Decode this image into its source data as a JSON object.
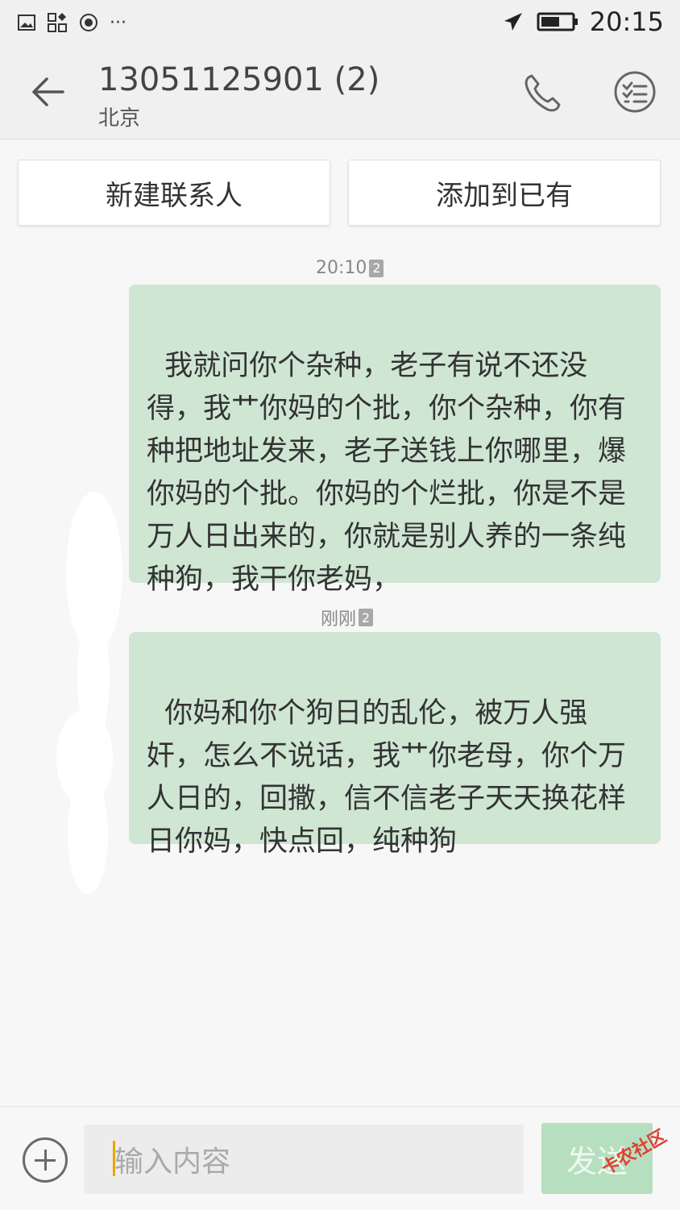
{
  "status_bar": {
    "time": "20:15"
  },
  "header": {
    "title": "13051125901 (2)",
    "subtitle": "北京"
  },
  "actions": {
    "new_contact": "新建联系人",
    "add_existing": "添加到已有"
  },
  "messages": [
    {
      "time": "20:10",
      "sim": "2",
      "text": "我就问你个杂种，老子有说不还没得，我艹你妈的个批，你个杂种，你有种把地址发来，老子送钱上你哪里，爆你妈的个批。你妈的个烂批，你是不是万人日出来的，你就是别人养的一条纯种狗，我干你老妈，"
    },
    {
      "time": "刚刚",
      "sim": "2",
      "text": "你妈和你个狗日的乱伦，被万人强奸，怎么不说话，我艹你老母，你个万人日的，回撒，信不信老子天天换花样日你妈，快点回，纯种狗"
    }
  ],
  "composer": {
    "placeholder": "输入内容",
    "send_label": "发送"
  },
  "watermark": "卡农社区"
}
